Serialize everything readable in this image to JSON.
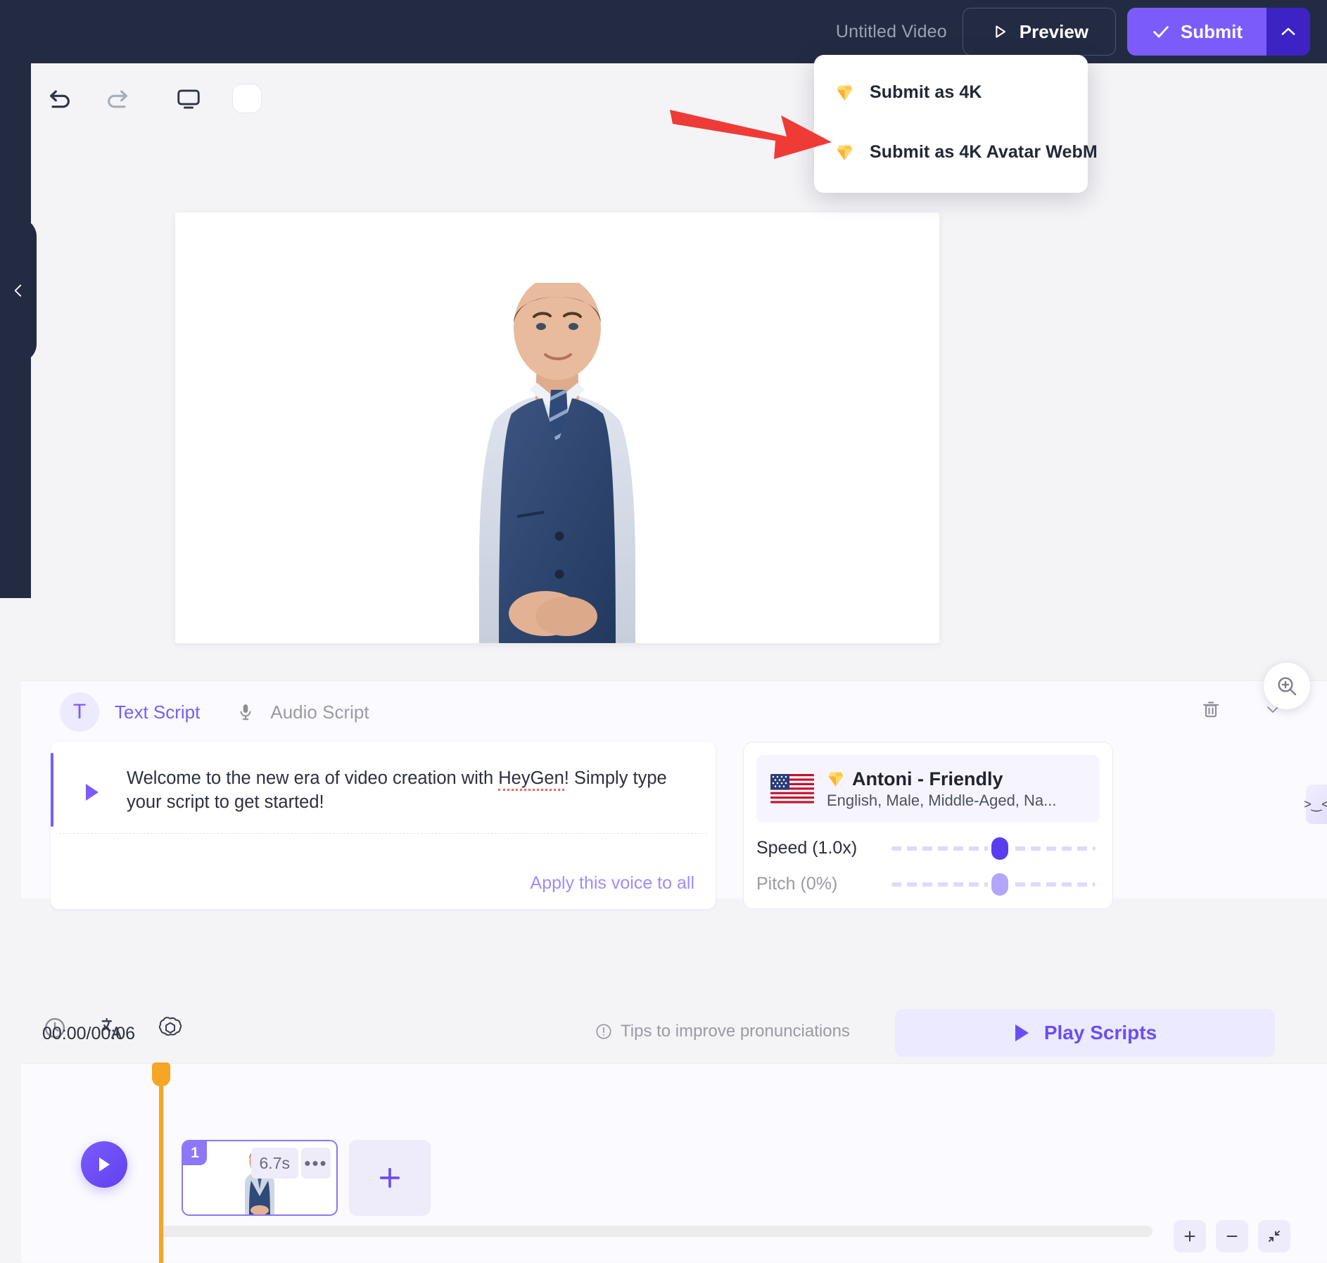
{
  "topbar": {
    "doc_title": "Untitled Video",
    "preview_label": "Preview",
    "submit_label": "Submit",
    "caret_icon": "chevron-up-icon",
    "accent_color": "#7b5cfa",
    "bg_color": "#232b43"
  },
  "submit_menu": {
    "items": [
      {
        "label": "Submit as 4K",
        "icon": "gem-icon"
      },
      {
        "label": "Submit as 4K Avatar WebM",
        "icon": "gem-icon"
      }
    ]
  },
  "annotation": {
    "arrow_color": "#ef3b36",
    "points_to": "Submit as 4K Avatar WebM"
  },
  "toolbar": {
    "undo_icon": "undo-icon",
    "redo_icon": "redo-icon",
    "screen_icon": "monitor-icon",
    "toggle_icon": "rounded-square-toggle"
  },
  "canvas": {
    "zoom_icon": "zoom-in-icon",
    "collapse_icon": "chevron-left-icon"
  },
  "script": {
    "tab_avatar_letter": "T",
    "tabs": [
      {
        "label": "Text Script",
        "active": true
      },
      {
        "label": "Audio Script",
        "active": false,
        "icon": "microphone-icon"
      }
    ],
    "delete_icon": "trash-icon",
    "collapse_icon": "chevron-down-icon",
    "text_part1": "Welcome to the new era of video creation with ",
    "text_misspelled": "HeyGen",
    "text_part2": "! Simply type your script to get started!",
    "apply_voice_label": "Apply this voice to all",
    "tips_label": "Tips to improve pronunciations",
    "tips_icon": "exclamation-circle-icon",
    "foot_icons": [
      "clock-icon",
      "translate-icon",
      "openai-icon"
    ],
    "play_scripts_label": "Play Scripts",
    "side_collapse_icon": "collapse-panel-icon"
  },
  "voice": {
    "flag": "us-flag",
    "quality_icon": "gem-icon",
    "name": "Antoni - Friendly",
    "meta": "English, Male, Middle-Aged, Na...",
    "speed_label": "Speed (1.0x)",
    "speed_value": 1.0,
    "speed_pct": 50,
    "pitch_label": "Pitch (0%)",
    "pitch_value": 0,
    "pitch_pct": 50
  },
  "timeline": {
    "play_icon": "play-icon",
    "scene_number": "1",
    "scene_duration": "6.7s",
    "scene_more_icon": "ellipsis-icon",
    "add_scene_icon": "plus-icon",
    "time_code": "00:00/00:06",
    "zoom_in_icon": "plus-icon",
    "zoom_out_icon": "minus-icon",
    "fit_icon": "fit-screen-icon"
  }
}
